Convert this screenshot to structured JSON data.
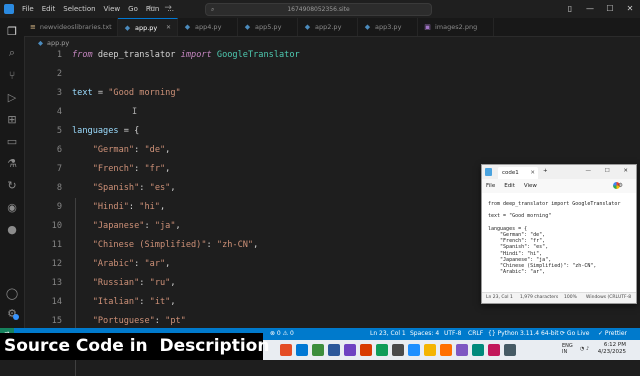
{
  "titlebar": {
    "menu": [
      "File",
      "Edit",
      "Selection",
      "View",
      "Go",
      "Run",
      "..."
    ],
    "command_center": "1674908052356.site",
    "nav_back": "←",
    "nav_forward": "→"
  },
  "tabs": [
    {
      "label": "newvideoslibraries.txt",
      "active": false
    },
    {
      "label": "app.py",
      "active": true
    },
    {
      "label": "app4.py",
      "active": false
    },
    {
      "label": "app5.py",
      "active": false
    },
    {
      "label": "app2.py",
      "active": false
    },
    {
      "label": "app3.py",
      "active": false
    },
    {
      "label": "images2.png",
      "active": false
    }
  ],
  "breadcrumb": "app.py",
  "editor": {
    "line_numbers": [
      "1",
      "2",
      "3",
      "4",
      "5",
      "6",
      "7",
      "8",
      "9",
      "10",
      "11",
      "12",
      "13",
      "14",
      "15"
    ],
    "lines": [
      "from deep_translator import GoogleTranslator",
      "",
      "text = \"Good morning\"",
      "",
      "languages = {",
      "    \"German\": \"de\",",
      "    \"French\": \"fr\",",
      "    \"Spanish\": \"es\",",
      "    \"Hindi\": \"hi\",",
      "    \"Japanese\": \"ja\",",
      "    \"Chinese (Simplified)\": \"zh-CN\",",
      "    \"Arabic\": \"ar\",",
      "    \"Russian\": \"ru\",",
      "    \"Italian\": \"it\",",
      "    \"Portuguese\": \"pt\""
    ]
  },
  "notepad": {
    "tab_title": "code1",
    "menu": [
      "File",
      "Edit",
      "View"
    ],
    "content": "from deep_translator import GoogleTranslator\n\ntext = \"Good morning\"\n\nlanguages = {\n    \"German\": \"de\",\n    \"French\": \"fr\",\n    \"Spanish\": \"es\",\n    \"Hindi\": \"hi\",\n    \"Japanese\": \"ja\",\n    \"Chinese (Simplified)\": \"zh-CN\",\n    \"Arabic\": \"ar\",",
    "status": {
      "position": "Ln 23, Col 1",
      "chars": "1,979 characters",
      "zoom": "100%",
      "eol": "Windows (CRL",
      "encoding": "UTF-8"
    }
  },
  "statusbar": {
    "errors": "⊗ 0 ⚠ 0",
    "position": "Ln 23, Col 1",
    "spaces": "Spaces: 4",
    "encoding": "UTF-8",
    "eol": "CRLF",
    "language": "{} Python",
    "version": "3.11.4 64-bit",
    "golive": "⟳ Go Live",
    "prettier": "✓ Prettier"
  },
  "taskbar": {
    "time": "6:12 PM",
    "date": "4/23/2025",
    "lang": "ENG",
    "region": "IN"
  },
  "banner": "Source Code in  Description",
  "colors": {
    "accent": "#007acc",
    "keyword": "#c586c0",
    "string": "#ce9178"
  }
}
